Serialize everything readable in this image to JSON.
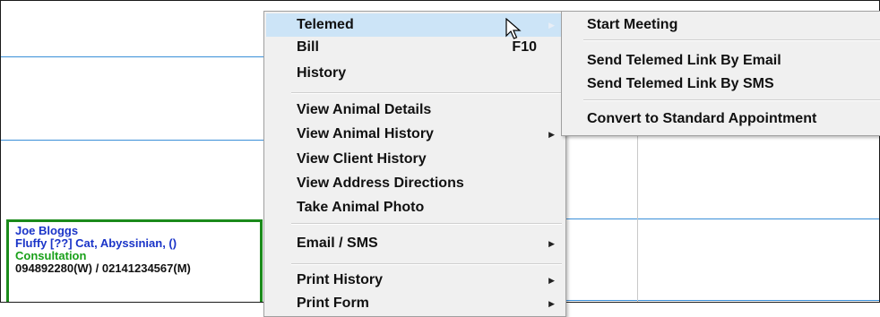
{
  "appointment": {
    "client_name": "Joe Bloggs",
    "patient": "Fluffy [??] Cat, Abyssinian,  ()",
    "type": "Consultation",
    "phone": "094892280(W) / 02141234567(M)"
  },
  "context_menu": {
    "items": [
      {
        "label": "Telemed"
      },
      {
        "label": "Bill",
        "shortcut": "F10"
      },
      {
        "label": "History"
      },
      {
        "label": "View Animal Details"
      },
      {
        "label": "View Animal History"
      },
      {
        "label": "View Client History"
      },
      {
        "label": "View Address Directions"
      },
      {
        "label": "Take Animal Photo"
      },
      {
        "label": "Email / SMS"
      },
      {
        "label": "Print History"
      },
      {
        "label": "Print Form"
      }
    ]
  },
  "telemed_submenu": {
    "items": [
      {
        "label": "Start Meeting"
      },
      {
        "label": "Send Telemed Link By Email"
      },
      {
        "label": "Send Telemed Link By SMS"
      },
      {
        "label": "Convert to Standard Appointment"
      }
    ]
  },
  "colors": {
    "grid_line": "#3a8fd8",
    "appointment_border": "#1a8a1a",
    "client_text": "#1a34c8",
    "type_text": "#1aa01a",
    "menu_highlight": "#cce4f7"
  }
}
